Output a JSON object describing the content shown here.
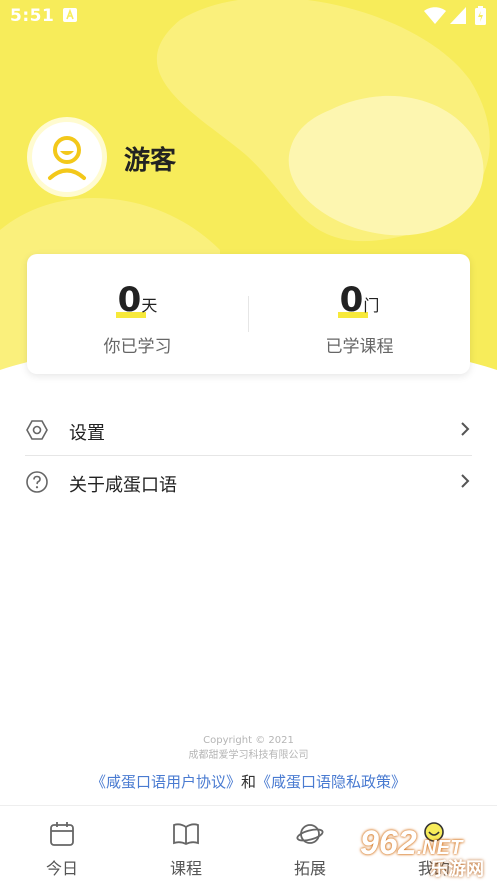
{
  "status_bar": {
    "time": "5:51"
  },
  "profile": {
    "username": "游客"
  },
  "stats": [
    {
      "value": "0",
      "unit": "天",
      "label": "你已学习"
    },
    {
      "value": "0",
      "unit": "门",
      "label": "已学课程"
    }
  ],
  "menu": [
    {
      "label": "设置",
      "icon": "hexagon-settings-icon"
    },
    {
      "label": "关于咸蛋口语",
      "icon": "help-circle-icon"
    }
  ],
  "footer": {
    "copyright": "Copyright © 2021",
    "company": "成都甜爱学习科技有限公司",
    "link_user_agreement": "《咸蛋口语用户协议》",
    "and_text": "和",
    "link_privacy": "《咸蛋口语隐私政策》"
  },
  "tabs": [
    {
      "label": "今日",
      "icon": "calendar-icon"
    },
    {
      "label": "课程",
      "icon": "book-icon"
    },
    {
      "label": "拓展",
      "icon": "planet-icon"
    },
    {
      "label": "我的",
      "icon": "smiley-icon"
    }
  ],
  "watermark": {
    "main": "962",
    "suffix": ".NET",
    "sub": "乐游网"
  },
  "colors": {
    "accent_yellow": "#f7ec5a",
    "link_blue": "#4a7bd1"
  }
}
